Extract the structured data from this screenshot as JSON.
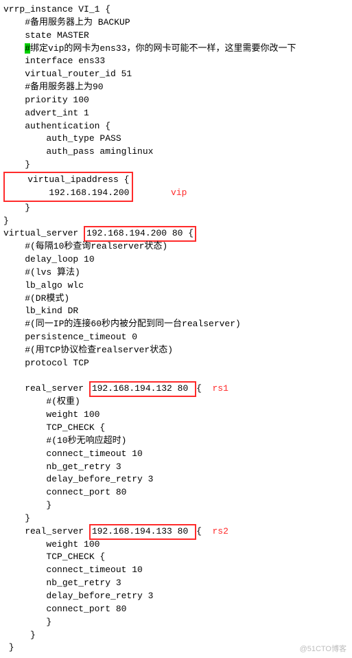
{
  "lines": {
    "l1": "vrrp_instance VI_1 {",
    "l2": "    #备用服务器上为 BACKUP",
    "l3": "    state MASTER",
    "l4a": "    ",
    "l4b": "#",
    "l4c": "绑定vip的网卡为ens33，你的网卡可能不一样，这里需要你改一下",
    "l5": "    interface ens33",
    "l6": "    virtual_router_id 51",
    "l7": "    #备用服务器上为90",
    "l8": "    priority 100",
    "l9": "    advert_int 1",
    "l10": "    authentication {",
    "l11": "        auth_type PASS",
    "l12": "        auth_pass aminglinux",
    "l13": "    }",
    "l14a": "    virtual_ipaddress {",
    "l14b": "        192.168.194.200",
    "vipLabel": "vip",
    "l15": "    }",
    "l16": "}",
    "l17a": "virtual_server ",
    "l17b": "192.168.194.200 80 {",
    "l18": "    #(每隔10秒查询realserver状态)",
    "l19": "    delay_loop 10",
    "l20": "    #(lvs 算法)",
    "l21": "    lb_algo wlc",
    "l22": "    #(DR模式)",
    "l23": "    lb_kind DR",
    "l24": "    #(同一IP的连接60秒内被分配到同一台realserver)",
    "l25": "    persistence_timeout 0",
    "l26": "    #(用TCP协议检查realserver状态)",
    "l27": "    protocol TCP",
    "l28": "",
    "l29a": "    real_server ",
    "l29b": "192.168.194.132 80 ",
    "l29c": "{  ",
    "rs1Label": "rs1",
    "l30": "        #(权重)",
    "l31": "        weight 100",
    "l32": "        TCP_CHECK {",
    "l33": "        #(10秒无响应超时)",
    "l34": "        connect_timeout 10",
    "l35": "        nb_get_retry 3",
    "l36": "        delay_before_retry 3",
    "l37": "        connect_port 80",
    "l38": "        }",
    "l39": "    }",
    "l40a": "    real_server ",
    "l40b": "192.168.194.133 80 ",
    "l40c": "{  ",
    "rs2Label": "rs2",
    "l41": "        weight 100",
    "l42": "        TCP_CHECK {",
    "l43": "        connect_timeout 10",
    "l44": "        nb_get_retry 3",
    "l45": "        delay_before_retry 3",
    "l46": "        connect_port 80",
    "l47": "        }",
    "l48": "     }",
    "l49": " }"
  },
  "watermark": "@51CTO博客"
}
